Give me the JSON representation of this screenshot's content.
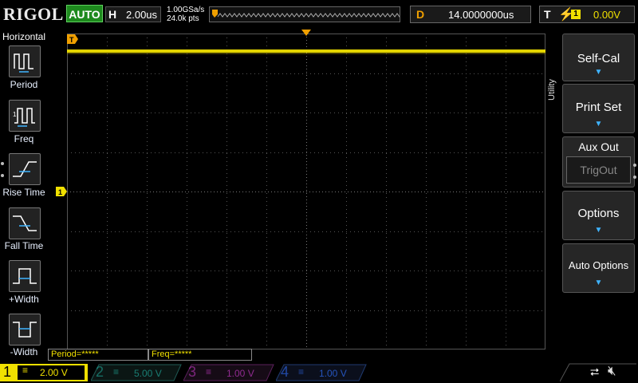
{
  "brand": "RIGOL",
  "status": "AUTO",
  "horizontal": {
    "letter": "H",
    "timebase": "2.00us",
    "sample_rate": "1.00GSa/s",
    "points": "24.0k pts"
  },
  "delay": {
    "letter": "D",
    "value": "14.0000000us"
  },
  "trigger": {
    "letter": "T",
    "source": "1",
    "level": "0.00V"
  },
  "left_menu": {
    "title": "Horizontal",
    "items": [
      {
        "label": "Period",
        "icon": "period-icon"
      },
      {
        "label": "Freq",
        "icon": "frequency-icon"
      },
      {
        "label": "Rise Time",
        "icon": "rise-time-icon"
      },
      {
        "label": "Fall Time",
        "icon": "fall-time-icon"
      },
      {
        "label": "+Width",
        "icon": "positive-width-icon"
      },
      {
        "label": "-Width",
        "icon": "negative-width-icon"
      }
    ]
  },
  "right_menu": {
    "tab_label": "Utility",
    "items": [
      {
        "label": "Self-Cal",
        "has_arrow": true
      },
      {
        "label": "Print Set",
        "has_arrow": true
      },
      {
        "label": "Aux Out",
        "value": "TrigOut"
      },
      {
        "label": "Options",
        "has_arrow": true
      },
      {
        "label": "Auto Options",
        "has_arrow": true
      }
    ]
  },
  "measurements": [
    "Period=*****",
    "Freq=*****"
  ],
  "channels": [
    {
      "num": "1",
      "scale": "2.00 V",
      "color": "#f0e000",
      "active": true
    },
    {
      "num": "2",
      "scale": "5.00 V",
      "color": "#22c0b0",
      "active": false
    },
    {
      "num": "3",
      "scale": "1.00 V",
      "color": "#e040e0",
      "active": false
    },
    {
      "num": "4",
      "scale": "1.00 V",
      "color": "#3070ff",
      "active": false
    }
  ],
  "colors": {
    "channel1": "#f0e000",
    "trigger_marker": "#f0a000",
    "accent_arrow": "#3fb4ff"
  }
}
